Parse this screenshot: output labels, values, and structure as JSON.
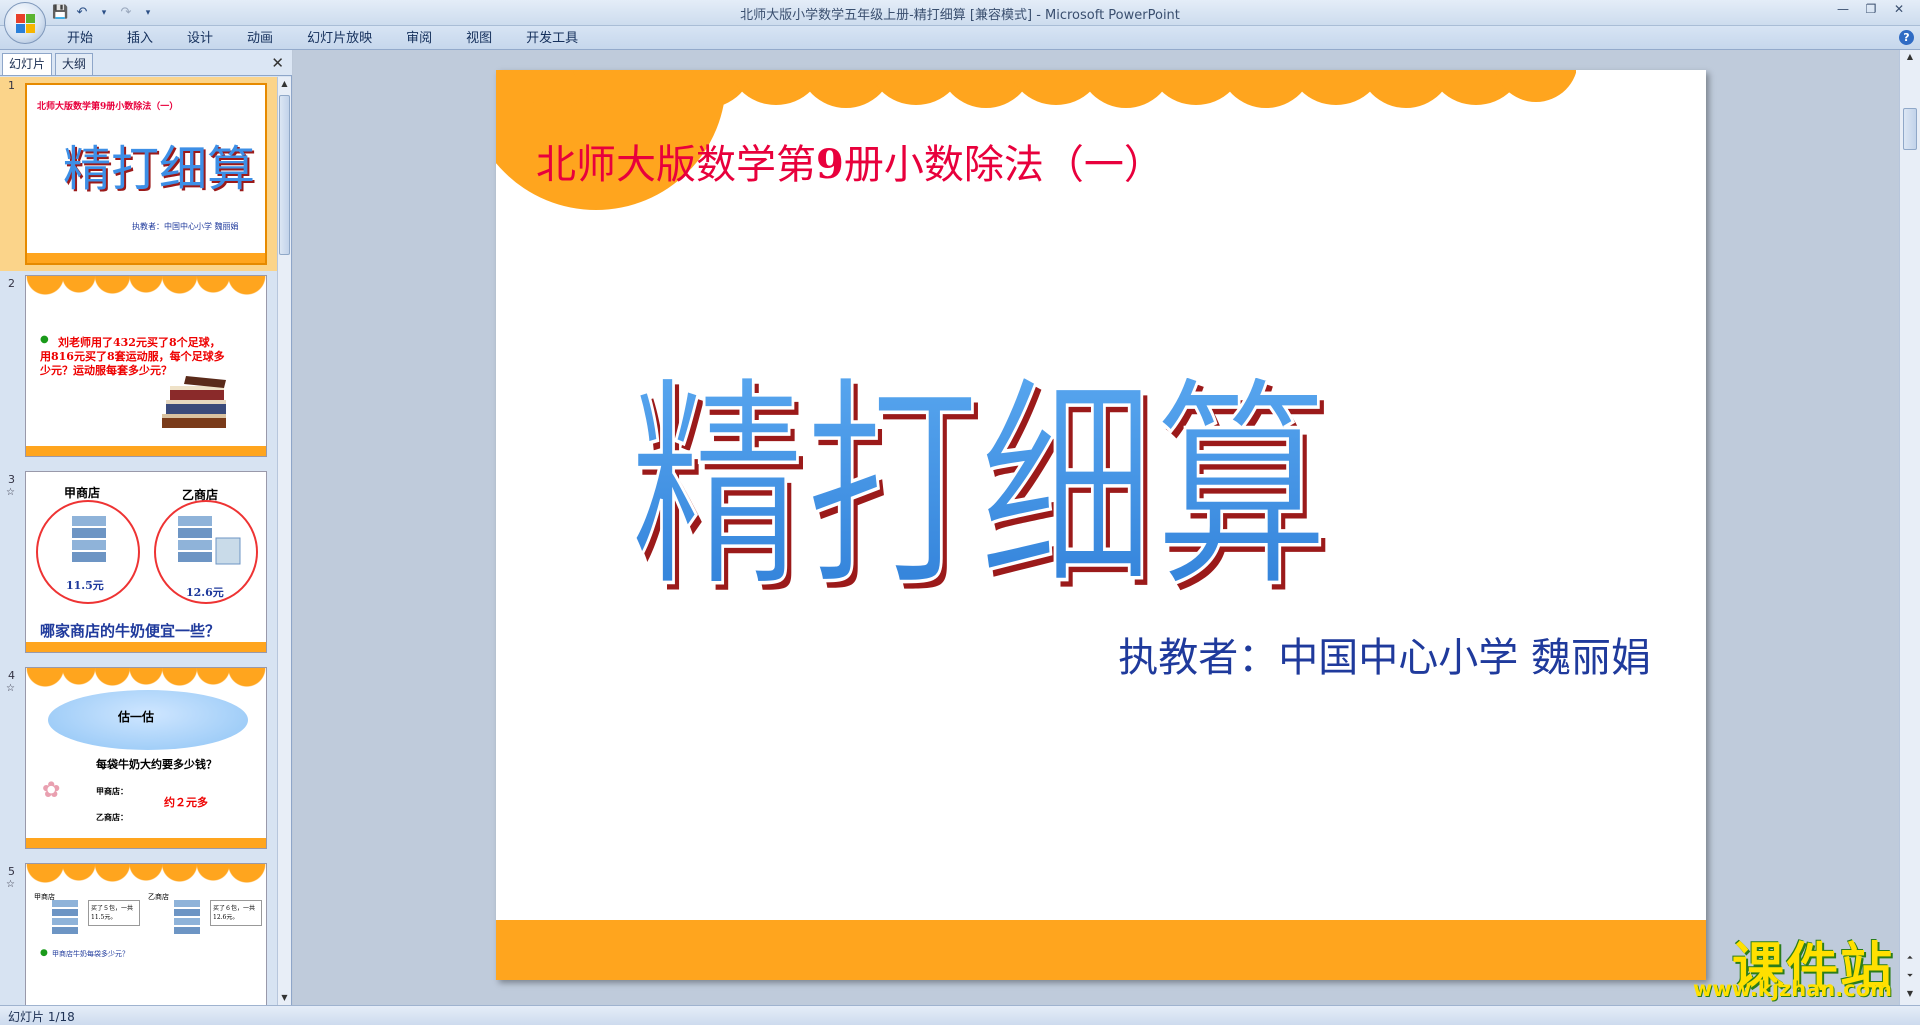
{
  "window": {
    "title": "北师大版小学数学五年级上册-精打细算 [兼容模式] - Microsoft PowerPoint"
  },
  "ribbon": {
    "tabs": [
      "开始",
      "插入",
      "设计",
      "动画",
      "幻灯片放映",
      "审阅",
      "视图",
      "开发工具"
    ]
  },
  "pane": {
    "tab_slides": "幻灯片",
    "tab_outline": "大纲",
    "close": "✕"
  },
  "thumbnails": [
    {
      "num": "1",
      "subtitle": "北师大版数学第9册小数除法（一）",
      "title": "精打细算",
      "author": "执教者：中国中心小学 魏丽娟"
    },
    {
      "num": "2",
      "text1": "刘老师用了432元买了8个足球，",
      "text2": "用816元买了8套运动服，每个足球多",
      "text3": "少元？运动服每套多少元？"
    },
    {
      "num": "3",
      "store_a": "甲商店",
      "store_b": "乙商店",
      "price_a": "11.5元",
      "price_b": "12.6元",
      "question": "哪家商店的牛奶便宜一些？"
    },
    {
      "num": "4",
      "cloud": "估一估",
      "question": "每袋牛奶大约要多少钱？",
      "line_a": "甲商店：",
      "line_b": "乙商店：",
      "answer": "约２元多"
    },
    {
      "num": "5",
      "store_a": "甲商店",
      "store_b": "乙商店",
      "note_a": "买了５包，一共11.5元。",
      "note_b": "买了６包，一共12.6元。",
      "question": "甲商店牛奶每袋多少元？"
    }
  ],
  "slide": {
    "subtitle_pre": "北师大版数学第",
    "subtitle_num": "9",
    "subtitle_post": "册小数除法（一）",
    "title": "精打细算",
    "author": "执教者：中国中心小学  魏丽娟"
  },
  "status": {
    "text": "幻灯片 1/18"
  },
  "watermark": {
    "text": "课件站",
    "url": "www.kjzhan.com"
  },
  "colors": {
    "orange": "#ffa51e",
    "subtitle_red": "#e8003c",
    "title_blue": "#3d8fe6",
    "author_blue": "#1f3a9c"
  }
}
